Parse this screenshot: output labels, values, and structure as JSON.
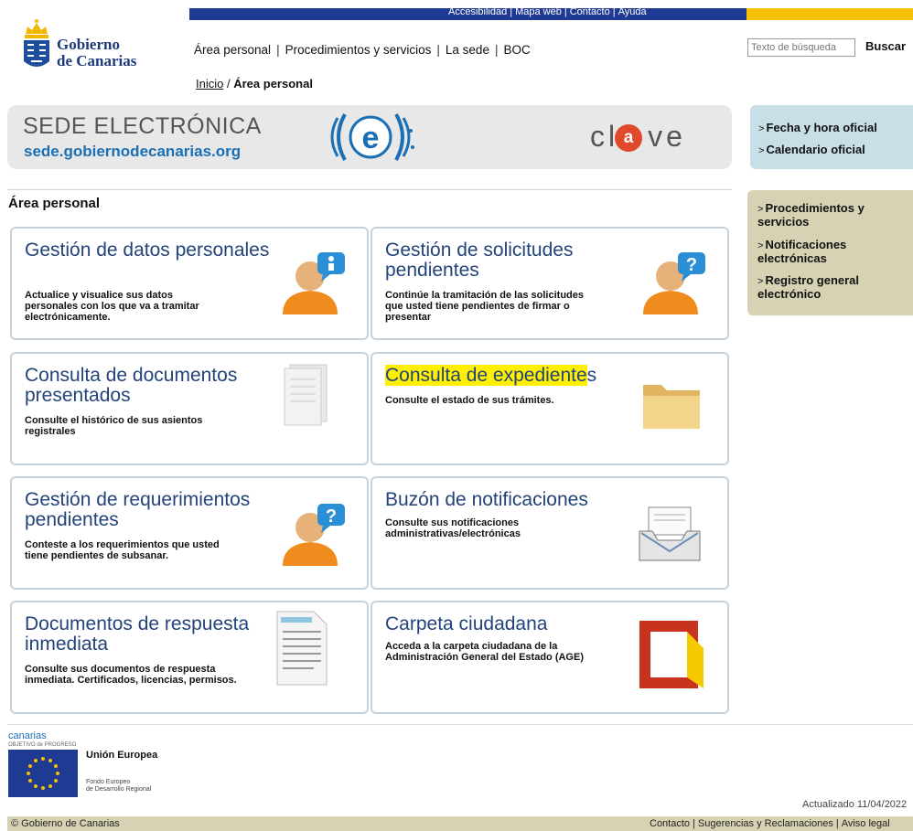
{
  "topbar": {
    "links": [
      "Accesibilidad",
      "Mapa web",
      "Contacto",
      "Ayuda"
    ]
  },
  "logo": {
    "line1": "Gobierno",
    "line2": "de Canarias"
  },
  "nav": {
    "items": [
      "Área personal",
      "Procedimientos y servicios",
      "La sede",
      "BOC"
    ]
  },
  "search": {
    "placeholder": "Texto de búsqueda",
    "button": "Buscar"
  },
  "breadcrumb": {
    "home": "Inicio",
    "separator": "/",
    "current": "Área personal"
  },
  "banner": {
    "title": "SEDE ELECTRÓNICA",
    "url": "sede.gobiernodecanarias.org",
    "clave_pre": "cl",
    "clave_a": "a",
    "clave_post": "ve",
    "e_letter": "e"
  },
  "right_blue": {
    "links": [
      "Fecha y hora oficial",
      "Calendario oficial"
    ]
  },
  "right_tan": {
    "links": [
      "Procedimientos y servicios",
      "Notificaciones electrónicas",
      "Registro general electrónico"
    ]
  },
  "section": {
    "title": "Área personal"
  },
  "cards": [
    {
      "title": "Gestión de datos personales",
      "desc": "Actualice y visualice sus datos personales con los que va a tramitar electrónicamente.",
      "icon": "user-info-icon"
    },
    {
      "title": "Gestión de solicitudes pendientes",
      "desc": "Continúe la tramitación de las solicitudes que usted tiene pendientes de firmar o presentar",
      "icon": "user-question-icon"
    },
    {
      "title": "Consulta de documentos presentados",
      "desc": "Consulte el histórico de sus asientos registrales",
      "icon": "documents-icon"
    },
    {
      "title_hl": "Consulta de expediente",
      "title_rest": "s",
      "desc": "Consulte el estado de sus trámites.",
      "icon": "folder-icon"
    },
    {
      "title": "Gestión de requerimientos pendientes",
      "desc": "Conteste a los requerimientos que usted tiene pendientes de subsanar.",
      "icon": "user-question-icon"
    },
    {
      "title": "Buzón de notificaciones",
      "desc": "Consulte sus notificaciones administrativas/electrónicas",
      "icon": "inbox-tray-icon"
    },
    {
      "title": "Documentos de respuesta inmediata",
      "desc": "Consulte sus documentos de respuesta inmediata. Certificados, licencias, permisos.",
      "icon": "document-text-icon"
    },
    {
      "title": "Carpeta ciudadana",
      "desc": "Acceda a la carpeta ciudadana de la Administración General del Estado (AGE)",
      "icon": "carpeta-ciudadana-logo"
    }
  ],
  "footer_logos": {
    "canarias": "canarias",
    "canarias_sub": "OBJETIVO de PROGRESO",
    "eu": "Unión Europea",
    "fondo1": "Fondo Europeo",
    "fondo2": "de Desarrollo Regional"
  },
  "footer": {
    "updated": "Actualizado 11/04/2022",
    "copyright": "© Gobierno de Canarias",
    "links": [
      "Contacto",
      "Sugerencias y Reclamaciones",
      "Aviso legal"
    ]
  },
  "colors": {
    "topbar": "#1f3a93",
    "accent_yellow": "#f5c000",
    "card_title": "#23437a",
    "clave_red": "#e0492c",
    "right_blue": "#c9dfe8",
    "right_tan": "#d7d2b4"
  }
}
